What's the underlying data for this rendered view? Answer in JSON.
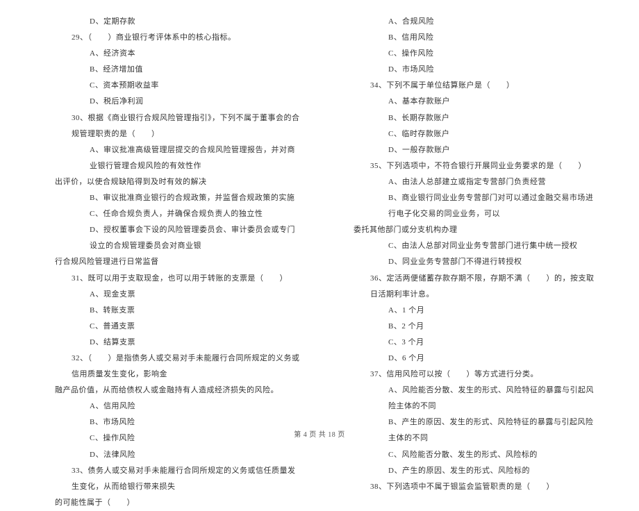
{
  "left_column": {
    "lines": [
      {
        "text": "D、定期存款",
        "indent": 2
      },
      {
        "text": "29、（　　）商业银行考评体系中的核心指标。",
        "indent": 1
      },
      {
        "text": "A、经济资本",
        "indent": 2
      },
      {
        "text": "B、经济增加值",
        "indent": 2
      },
      {
        "text": "C、资本预期收益率",
        "indent": 2
      },
      {
        "text": "D、税后净利润",
        "indent": 2
      },
      {
        "text": "30、根据《商业银行合规风险管理指引》，下列不属于董事会的合规管理职责的是（　　）",
        "indent": 1
      },
      {
        "text": "A、审议批准高级管理层提交的合规风险管理报告，并对商业银行管理合规风险的有效性作",
        "indent": 2
      },
      {
        "text": "出评价，以使合规缺陷得到及时有效的解决",
        "indent": 0
      },
      {
        "text": "B、审议批准商业银行的合规政策，并监督合规政策的实施",
        "indent": 2
      },
      {
        "text": "C、任命合规负责人，并确保合规负责人的独立性",
        "indent": 2
      },
      {
        "text": "D、授权董事会下设的风险管理委员会、审计委员会或专门设立的合规管理委员会对商业银",
        "indent": 2
      },
      {
        "text": "行合规风险管理进行日常监督",
        "indent": 0
      },
      {
        "text": "31、既可以用于支取现金，也可以用于转账的支票是（　　）",
        "indent": 1
      },
      {
        "text": "A、现金支票",
        "indent": 2
      },
      {
        "text": "B、转账支票",
        "indent": 2
      },
      {
        "text": "C、普通支票",
        "indent": 2
      },
      {
        "text": "D、结算支票",
        "indent": 2
      },
      {
        "text": "32、（　　）是指债务人或交易对手未能履行合同所规定的义务或信用质量发生变化，影响金",
        "indent": 1
      },
      {
        "text": "融产品价值，从而给债权人或金融持有人造成经济损失的风险。",
        "indent": 0
      },
      {
        "text": "A、信用风险",
        "indent": 2
      },
      {
        "text": "B、市场风险",
        "indent": 2
      },
      {
        "text": "C、操作风险",
        "indent": 2
      },
      {
        "text": "D、法律风险",
        "indent": 2
      },
      {
        "text": "33、债务人或交易对手未能履行合同所规定的义务或信任质量发生变化，从而给银行带来损失",
        "indent": 1
      },
      {
        "text": "的可能性属于（　　）",
        "indent": 0
      }
    ]
  },
  "right_column": {
    "lines": [
      {
        "text": "A、合规风险",
        "indent": 2
      },
      {
        "text": "B、信用风险",
        "indent": 2
      },
      {
        "text": "C、操作风险",
        "indent": 2
      },
      {
        "text": "D、市场风险",
        "indent": 2
      },
      {
        "text": "34、下列不属于单位结算账户是（　　）",
        "indent": 1
      },
      {
        "text": "A、基本存款账户",
        "indent": 2
      },
      {
        "text": "B、长期存款账户",
        "indent": 2
      },
      {
        "text": "C、临时存款账户",
        "indent": 2
      },
      {
        "text": "D、一般存款账户",
        "indent": 2
      },
      {
        "text": "35、下列选项中，不符合银行开展同业业务要求的是（　　）",
        "indent": 1
      },
      {
        "text": "A、由法人总部建立或指定专营部门负责经营",
        "indent": 2
      },
      {
        "text": "B、商业银行同业业务专营部门对可以通过金融交易市场进行电子化交易的同业业务，可以",
        "indent": 2
      },
      {
        "text": "委托其他部门或分支机构办理",
        "indent": 0
      },
      {
        "text": "C、由法人总部对同业业务专营部门进行集中统一授权",
        "indent": 2
      },
      {
        "text": "D、同业业务专营部门不得进行转授权",
        "indent": 2
      },
      {
        "text": "36、定活两便储蓄存款存期不限，存期不满（　　）的，按支取日活期利率计息。",
        "indent": 1
      },
      {
        "text": "A、1 个月",
        "indent": 2
      },
      {
        "text": "B、2 个月",
        "indent": 2
      },
      {
        "text": "C、3 个月",
        "indent": 2
      },
      {
        "text": "D、6 个月",
        "indent": 2
      },
      {
        "text": "37、信用风险可以按（　　）等方式进行分类。",
        "indent": 1
      },
      {
        "text": "A、风险能否分散、发生的形式、风险特征的暴露与引起风险主体的不同",
        "indent": 2
      },
      {
        "text": "B、产生的原因、发生的形式、风险特征的暴露与引起风险主体的不同",
        "indent": 2
      },
      {
        "text": "C、风险能否分散、发生的形式、风险标的",
        "indent": 2
      },
      {
        "text": "D、产生的原因、发生的形式、风险标的",
        "indent": 2
      },
      {
        "text": "38、下列选项中不属于银监会监管职责的是（　　）",
        "indent": 1
      }
    ]
  },
  "footer": {
    "text": "第 4 页 共 18 页"
  }
}
